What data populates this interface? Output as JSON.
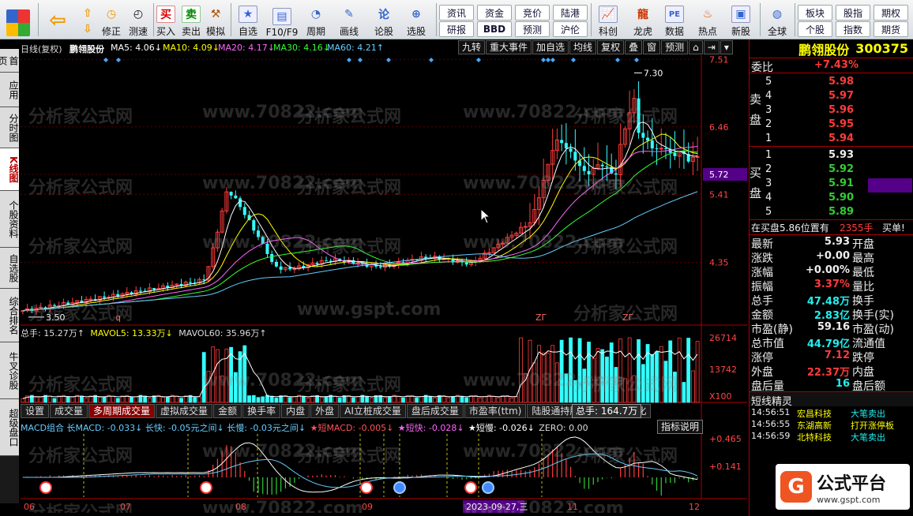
{
  "toolbar": {
    "buttons": [
      "买入",
      "卖出",
      "模拟",
      "自选",
      "F10/F9",
      "周期",
      "画线",
      "论股",
      "选股",
      "科创",
      "龙虎",
      "数据",
      "热点",
      "新股",
      "全球"
    ],
    "nav_buttons": [
      "修正",
      "测速"
    ],
    "small": [
      "资讯",
      "资金",
      "竞价",
      "陆港",
      "研报",
      "BBD",
      "预测",
      "沪伦",
      "板块",
      "股指",
      "期权",
      "个股",
      "指数",
      "期货"
    ],
    "colors": {
      "accent": "#0050b0"
    }
  },
  "left_tabs": [
    "首页",
    "应用",
    "分时图",
    "K线图",
    "个股资料",
    "自选股",
    "综合排名",
    "牛叉诊股",
    "超级盘口"
  ],
  "top_line": {
    "period": "日线(复权)",
    "stock": "鹏翎股份",
    "ma5": "MA5: 4.06↓",
    "ma10": "MA10: 4.09↓",
    "ma20": "MA20: 4.17↓",
    "ma30": "MA30: 4.16↓",
    "ma60": "MA60: 4.21↑",
    "tools": [
      "九转",
      "重大事件",
      "加自选",
      "均线",
      "复权",
      "叠",
      "窗",
      "预测"
    ]
  },
  "price_axis": {
    "ticks": [
      "7.51",
      "6.46",
      "5.72",
      "5.41",
      "4.35"
    ],
    "high_label": "7.30",
    "low_label": "3.50",
    "markers": [
      "q",
      "ΖΓ",
      "ΖΓ"
    ]
  },
  "volume": {
    "label": "总手: 15.27万↑",
    "mavol5": "MAVOL5: 13.33万↓",
    "mavol60": "MAVOL60: 35.96万↑",
    "ticks": [
      "26714",
      "13742",
      "X100"
    ],
    "tooltip": "总手: 164.7万"
  },
  "indicator_tabs": [
    "设置",
    "成交量",
    "多周期成交量",
    "虚拟成交量",
    "金额",
    "换手率",
    "内盘",
    "外盘",
    "AI立桩成交量",
    "盘后成交量",
    "市盈率(ttm)",
    "陆股通持股",
    "融资融券变化"
  ],
  "macd": {
    "label": "MACD组合 长MACD: -0.033↓ 长快: -0.05元之间↓ 长慢: -0.03元之间↓",
    "short_macd": "★短MACD: -0.005↓",
    "short_fast": "★短快: -0.028↓",
    "short_slow": "★短慢: -0.026↓",
    "zero": "ZERO: 0.00",
    "ticks": [
      "+0.465",
      "+0.141"
    ],
    "indicator_desc": "指标说明"
  },
  "date_axis": [
    "06",
    "07",
    "08",
    "09",
    "11",
    "12"
  ],
  "date_highlight": "2023-09-27,三",
  "right_panel": {
    "name": "鹏翎股份",
    "code": "300375",
    "weibi_label": "委比",
    "weibi": "+7.43%",
    "sell_side": "卖盘",
    "buy_side": "买盘",
    "sell": [
      {
        "lvl": "5",
        "price": "5.98"
      },
      {
        "lvl": "4",
        "price": "5.97"
      },
      {
        "lvl": "3",
        "price": "5.96"
      },
      {
        "lvl": "2",
        "price": "5.95"
      },
      {
        "lvl": "1",
        "price": "5.94"
      }
    ],
    "buy": [
      {
        "lvl": "1",
        "price": "5.93"
      },
      {
        "lvl": "2",
        "price": "5.92"
      },
      {
        "lvl": "3",
        "price": "5.91"
      },
      {
        "lvl": "4",
        "price": "5.90"
      },
      {
        "lvl": "5",
        "price": "5.89"
      }
    ],
    "notice": "在买盘5.86位置有",
    "notice_vol": "2355手",
    "notice_tag": "买单!",
    "stats": [
      {
        "l": "最新",
        "v": "5.93",
        "r": "开盘"
      },
      {
        "l": "涨跌",
        "v": "+0.00",
        "r": "最高"
      },
      {
        "l": "涨幅",
        "v": "+0.00%",
        "r": "最低"
      },
      {
        "l": "振幅",
        "v": "3.37%",
        "r": "量比"
      },
      {
        "l": "总手",
        "v": "47.48万",
        "r": "换手"
      },
      {
        "l": "金额",
        "v": "2.83亿",
        "r": "换手(实)"
      },
      {
        "l": "市盈(静)",
        "v": "59.16",
        "r": "市盈(动)"
      },
      {
        "l": "总市值",
        "v": "44.79亿",
        "r": "流通值"
      },
      {
        "l": "涨停",
        "v": "7.12",
        "r": "跌停"
      },
      {
        "l": "外盘",
        "v": "22.37万",
        "r": "内盘"
      },
      {
        "l": "盘后量",
        "v": "16",
        "r": "盘后额"
      }
    ],
    "short_title": "短线精灵",
    "ticks": [
      {
        "t": "14:56:51",
        "n": "宏昌科技",
        "e": "大笔卖出"
      },
      {
        "t": "14:56:55",
        "n": "东湖高新",
        "e": "打开涨停板"
      },
      {
        "t": "14:56:59",
        "n": "北特科技",
        "e": "大笔卖出"
      }
    ]
  },
  "logo": {
    "brand": "公式平台",
    "url": "www.gspt.com"
  },
  "watermark": [
    "分析家公式网",
    "www.70822.com",
    "www.gspt.com"
  ]
}
